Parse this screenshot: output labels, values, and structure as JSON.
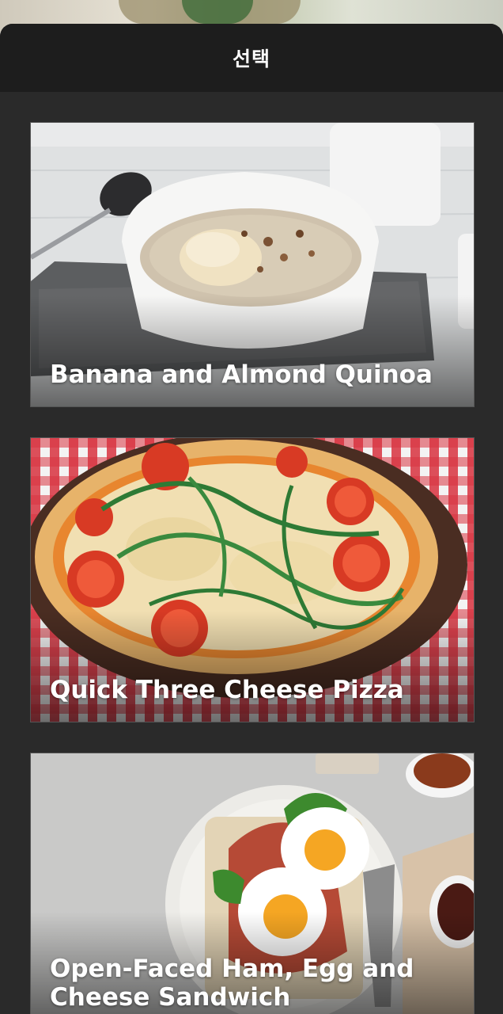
{
  "sheet": {
    "title": "선택"
  },
  "recipes": [
    {
      "title": "Banana and Almond Quinoa",
      "image": "quinoa-bowl-photo"
    },
    {
      "title": "Quick Three Cheese Pizza",
      "image": "pizza-photo"
    },
    {
      "title": "Open-Faced Ham, Egg and Cheese Sandwich",
      "image": "egg-sandwich-photo"
    }
  ]
}
